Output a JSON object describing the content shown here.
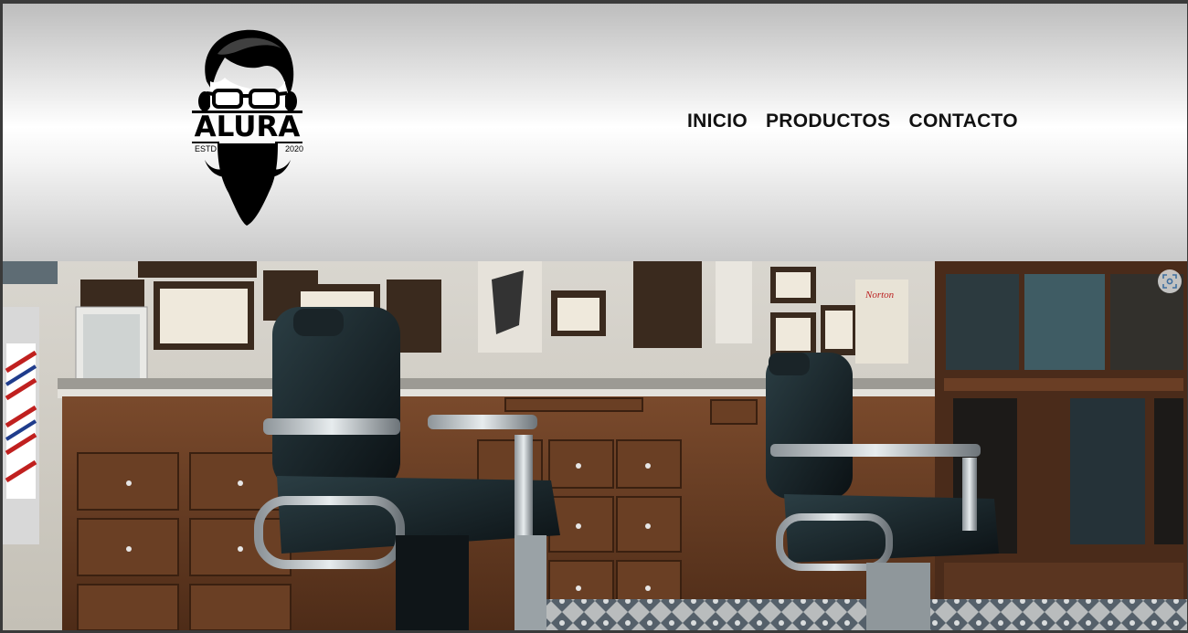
{
  "brand": {
    "name": "ALURA",
    "est_label": "ESTD",
    "year": "2020"
  },
  "nav": {
    "items": [
      {
        "label": "INICIO"
      },
      {
        "label": "PRODUCTOS"
      },
      {
        "label": "CONTACTO"
      }
    ]
  },
  "hero": {
    "image": "barbershop-interior-image",
    "sign_text": "Norton"
  },
  "icons": {
    "logo": "bearded-man-logo-icon",
    "lens": "visual-search-icon"
  }
}
